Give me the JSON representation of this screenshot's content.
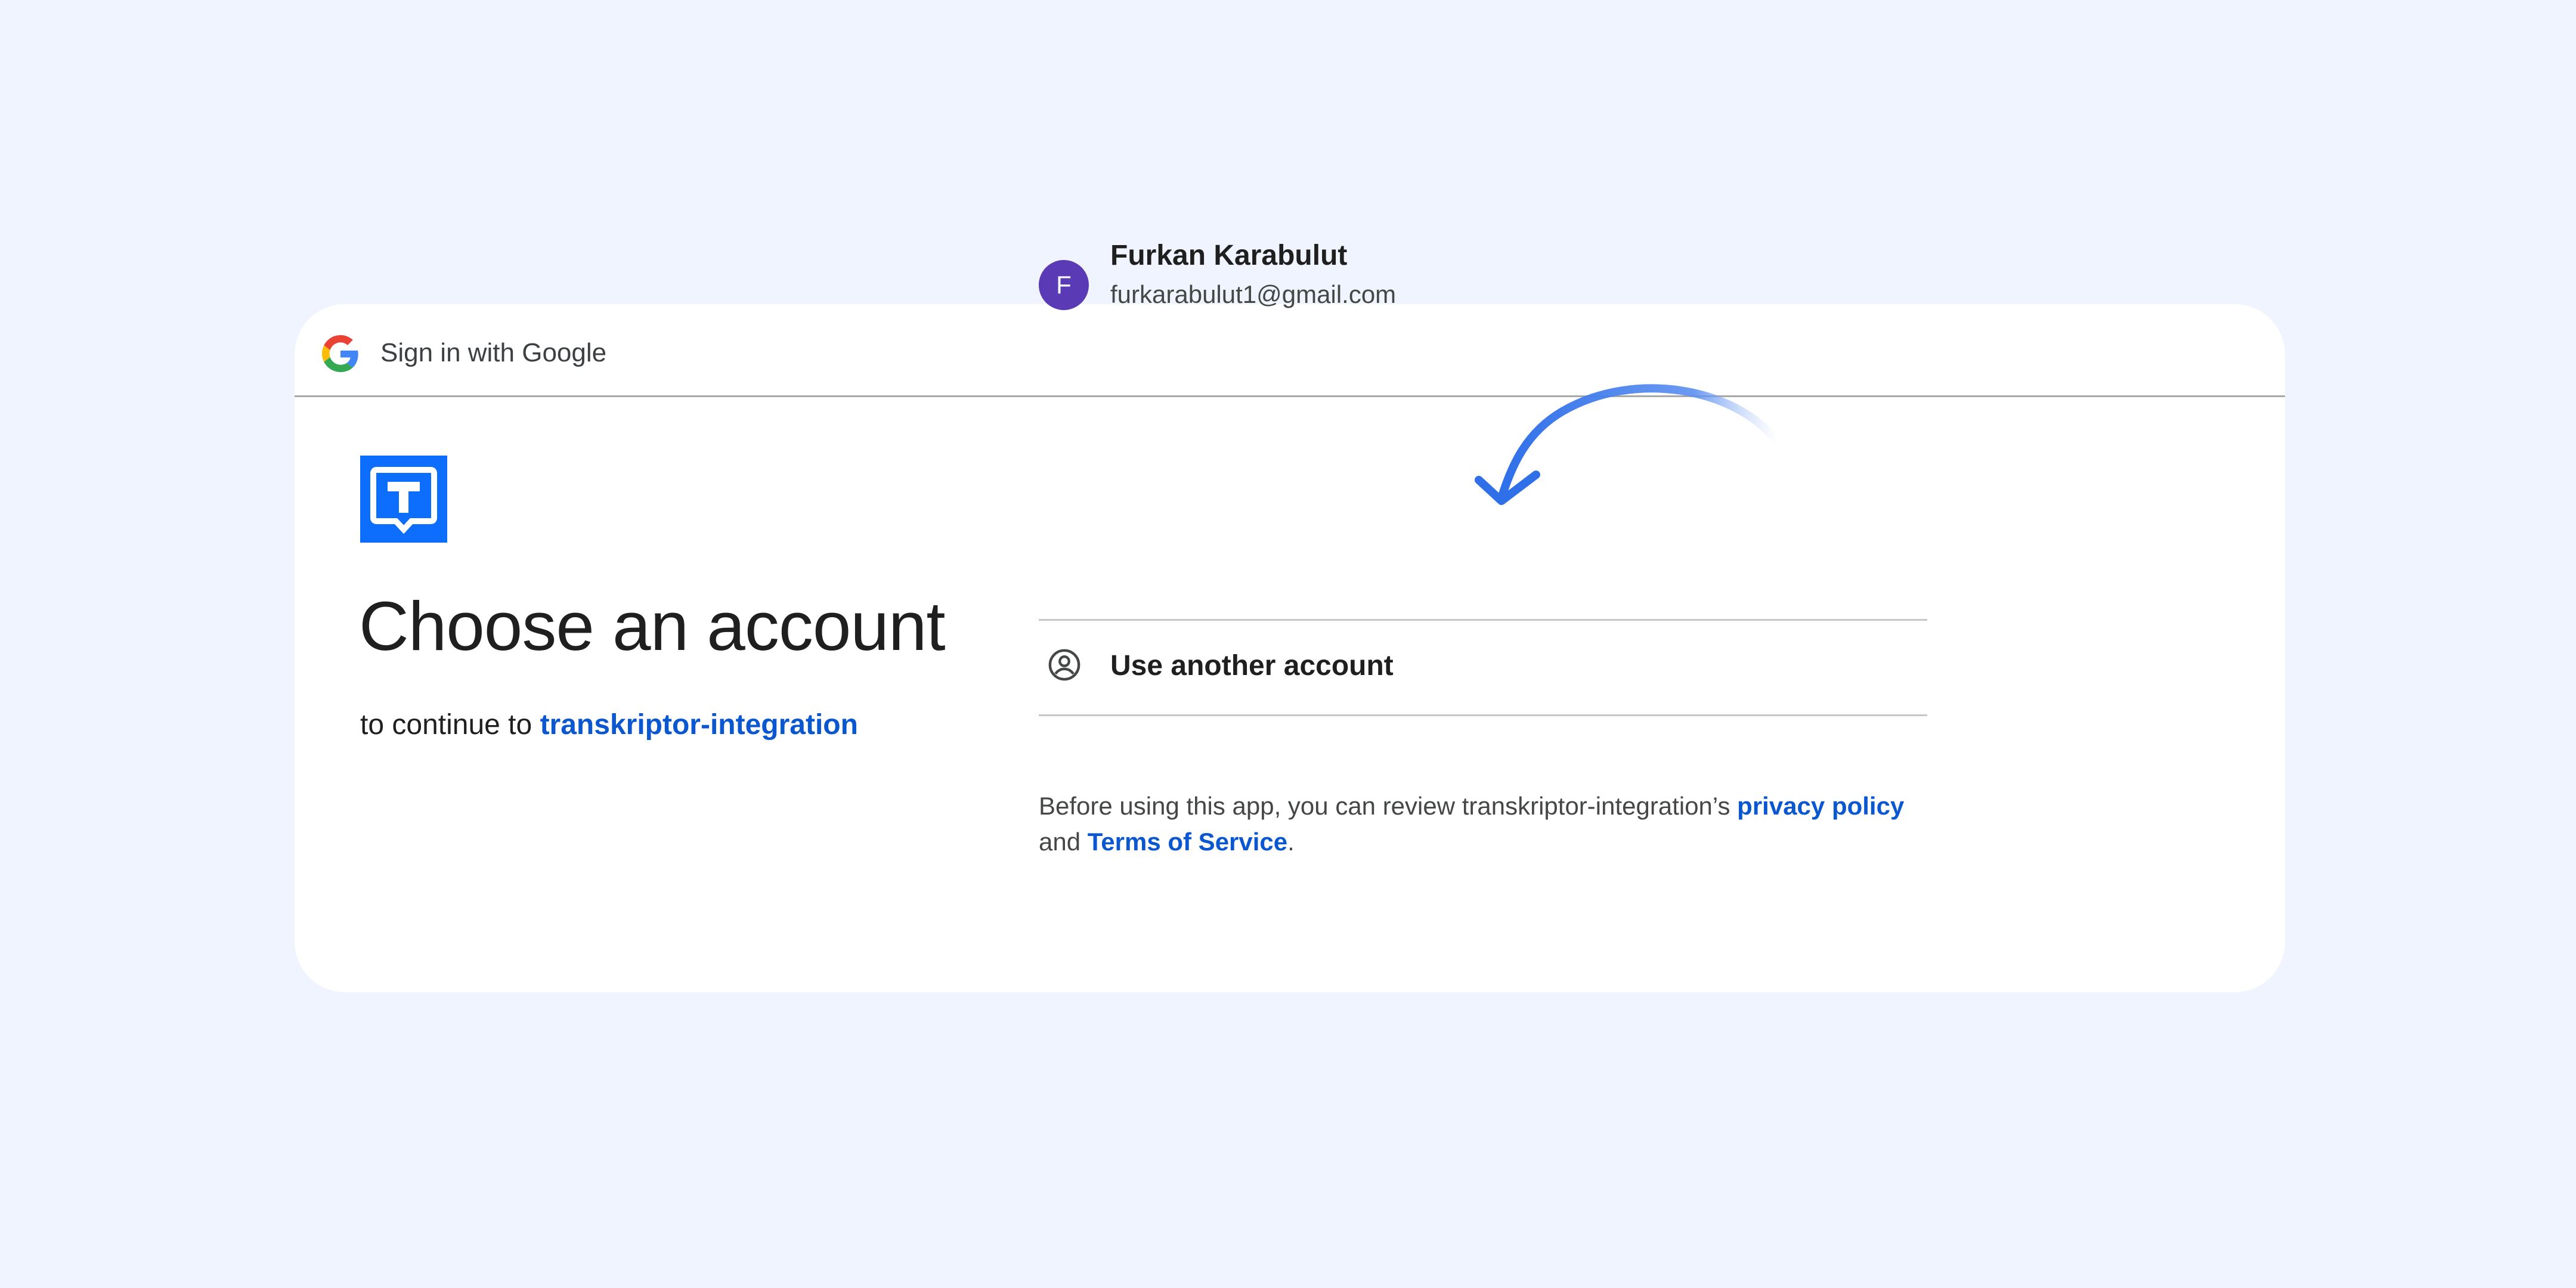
{
  "header": {
    "title": "Sign in with Google",
    "logo_icon": "google-g-icon"
  },
  "app": {
    "logo_icon": "transkriptor-t-icon",
    "logo_color": "#0d6efd"
  },
  "main": {
    "heading": "Choose an account",
    "continue_prefix": "to continue to",
    "app_name": "transkriptor-integration"
  },
  "account": {
    "avatar_initial": "F",
    "avatar_color": "#5b3bb5",
    "name": "Furkan Karabulut",
    "email": "furkarabulut1@gmail.com"
  },
  "other_account": {
    "label": "Use another account",
    "icon": "person-circle-icon"
  },
  "disclaimer": {
    "prefix": "Before using this app, you can review transkriptor-integration’s",
    "privacy_link": "privacy policy",
    "and": "and",
    "terms_link": "Terms of Service",
    "period": "."
  },
  "colors": {
    "link": "#0b57d0",
    "background": "#eff4fe",
    "arrow": "#3a7bf0"
  }
}
